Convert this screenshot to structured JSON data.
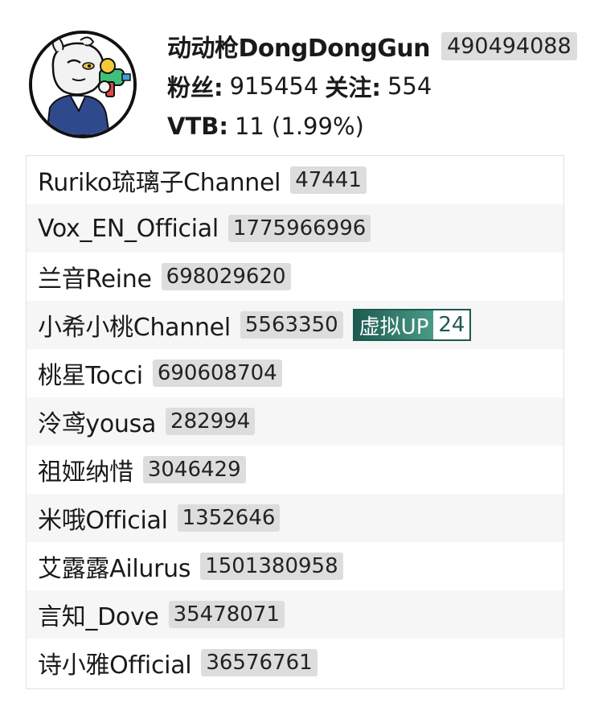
{
  "user": {
    "name": "动动枪DongDongGun",
    "uid": "490494088",
    "fans_label": "粉丝:",
    "fans": "915454",
    "follow_label": "关注:",
    "follow": "554",
    "vtb_label": "VTB:",
    "vtb": "11 (1.99%)"
  },
  "following": [
    {
      "name": "Ruriko琉璃子Channel",
      "uid": "47441"
    },
    {
      "name": "Vox_EN_Official",
      "uid": "1775966996"
    },
    {
      "name": "兰音Reine",
      "uid": "698029620"
    },
    {
      "name": "小希小桃Channel",
      "uid": "5563350",
      "tag": "虚拟UP",
      "tag_count": "24"
    },
    {
      "name": "桃星Tocci",
      "uid": "690608704"
    },
    {
      "name": "泠鸢yousa",
      "uid": "282994"
    },
    {
      "name": "祖娅纳惜",
      "uid": "3046429"
    },
    {
      "name": "米哦Official",
      "uid": "1352646"
    },
    {
      "name": "艾露露Ailurus",
      "uid": "1501380958"
    },
    {
      "name": "言知_Dove",
      "uid": "35478071"
    },
    {
      "name": "诗小雅Official",
      "uid": "36576761"
    }
  ],
  "colors": {
    "badge_bg": "#dddddd",
    "tag_dark": "#1d5b51",
    "tag_light": "#4a9a86",
    "row_alt": "#f6f6f6"
  }
}
